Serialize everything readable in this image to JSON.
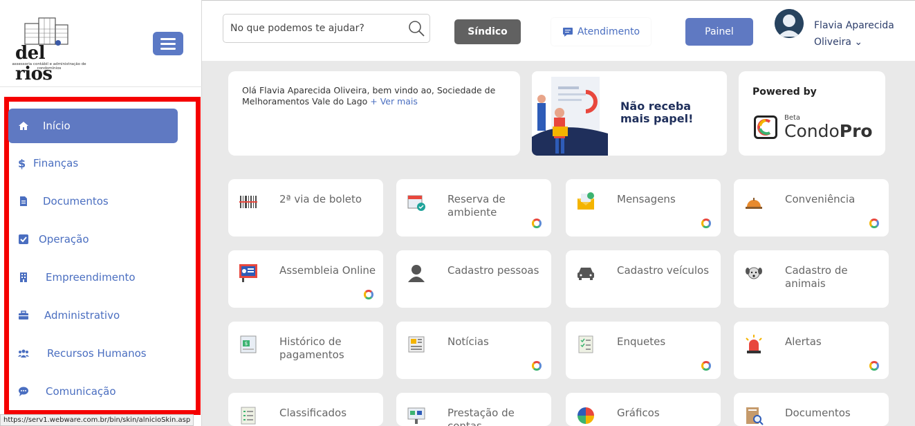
{
  "logo": {
    "brand": "del rios",
    "tagline": "assessoria contábil e administração de condomínios"
  },
  "sidebar": {
    "items": [
      {
        "label": "Início",
        "icon": "home-icon",
        "active": true
      },
      {
        "label": "Finanças",
        "icon": "dollar-icon"
      },
      {
        "label": "Documentos",
        "icon": "document-icon"
      },
      {
        "label": "Operação",
        "icon": "checkbox-icon"
      },
      {
        "label": "Empreendimento",
        "icon": "building-icon"
      },
      {
        "label": "Administrativo",
        "icon": "briefcase-icon"
      },
      {
        "label": "Recursos Humanos",
        "icon": "users-icon"
      },
      {
        "label": "Comunicação",
        "icon": "chat-icon"
      }
    ]
  },
  "status_url": "https://serv1.webware.com.br/bin/skin/alnicioSkin.asp",
  "header": {
    "search_placeholder": "No que podemos te ajudar?",
    "sindico_label": "Síndico",
    "atendimento_label": "Atendimento",
    "painel_label": "Painel",
    "user_name_line1": "Flavia Aparecida",
    "user_name_line2": "Oliveira ⌄"
  },
  "welcome": {
    "text": "Olá Flavia Aparecida Oliveira, bem vindo ao, Sociedade de Melhoramentos Vale do Lago",
    "more": "+ Ver mais"
  },
  "banner": {
    "line1": "Não receba",
    "line2": "mais papel!"
  },
  "powered": {
    "title": "Powered by",
    "beta": "Beta",
    "brand_a": "Condo",
    "brand_b": "Pro"
  },
  "tiles": [
    {
      "label": "2ª via de boleto",
      "icon": "barcode-icon",
      "ring": false
    },
    {
      "label": "Reserva de ambiente",
      "icon": "calendar-icon",
      "ring": true
    },
    {
      "label": "Mensagens",
      "icon": "envelope-icon",
      "ring": true
    },
    {
      "label": "Conveniência",
      "icon": "service-bell-icon",
      "ring": true
    },
    {
      "label": "Assembleia Online",
      "icon": "presentation-icon",
      "ring": true
    },
    {
      "label": "Cadastro pessoas",
      "icon": "person-icon",
      "ring": false
    },
    {
      "label": "Cadastro veículos",
      "icon": "car-icon",
      "ring": false
    },
    {
      "label": "Cadastro de animais",
      "icon": "dog-icon",
      "ring": false
    },
    {
      "label": "Histórico de pagamentos",
      "icon": "receipt-icon",
      "ring": false
    },
    {
      "label": "Notícias",
      "icon": "newspaper-icon",
      "ring": true
    },
    {
      "label": "Enquetes",
      "icon": "survey-icon",
      "ring": true
    },
    {
      "label": "Alertas",
      "icon": "siren-icon",
      "ring": true
    },
    {
      "label": "Classificados",
      "icon": "list-icon",
      "ring": false
    },
    {
      "label": "Prestação de contas",
      "icon": "accounts-icon",
      "ring": false
    },
    {
      "label": "Gráficos",
      "icon": "pie-chart-icon",
      "ring": false
    },
    {
      "label": "Documentos",
      "icon": "folder-search-icon",
      "ring": false
    }
  ],
  "colors": {
    "accent": "#5f79c2",
    "link": "#4a6ec0",
    "highlight_box": "#f50000",
    "sindico_bg": "#616161"
  }
}
